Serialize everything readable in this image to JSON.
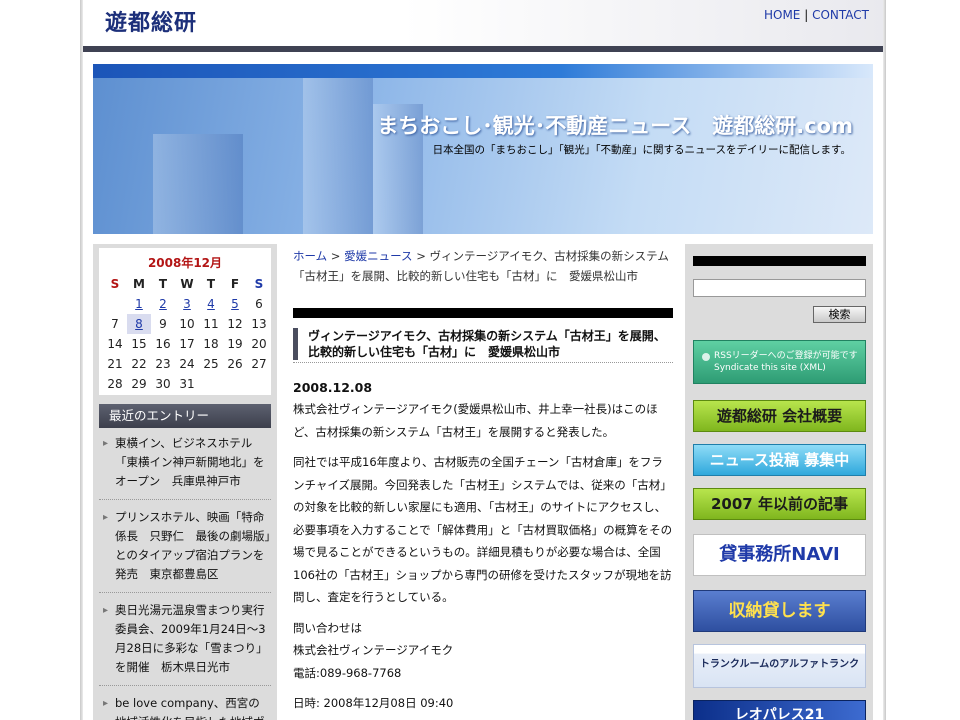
{
  "header": {
    "logo": "遊都総研",
    "nav_home": "HOME",
    "nav_sep": "|",
    "nav_contact": "CONTACT"
  },
  "banner": {
    "title": "まちおこし･観光･不動産ニュース　遊都総研.com",
    "subtitle": "日本全国の「まちおこし」「観光」「不動産」に関するニュースをデイリーに配信します。"
  },
  "calendar": {
    "title": "2008年12月",
    "weekdays": [
      "S",
      "M",
      "T",
      "W",
      "T",
      "F",
      "S"
    ],
    "weeks": [
      [
        "",
        "1",
        "2",
        "3",
        "4",
        "5",
        "6"
      ],
      [
        "7",
        "8",
        "9",
        "10",
        "11",
        "12",
        "13"
      ],
      [
        "14",
        "15",
        "16",
        "17",
        "18",
        "19",
        "20"
      ],
      [
        "21",
        "22",
        "23",
        "24",
        "25",
        "26",
        "27"
      ],
      [
        "28",
        "29",
        "30",
        "31",
        "",
        "",
        ""
      ]
    ]
  },
  "recent": {
    "heading": "最近のエントリー",
    "items": [
      "東横イン、ビジネスホテル「東横イン神戸新開地北」をオープン　兵庫県神戸市",
      "プリンスホテル、映画「特命係長　只野仁　最後の劇場版」とのタイアップ宿泊プランを発売　東京都豊島区",
      "奥日光湯元温泉雪まつり実行委員会、2009年1月24日～3月28日に多彩な「雪まつり」を開催　栃木県日光市",
      "be love company、西宮の地域活性化を目指した地域ポ"
    ]
  },
  "breadcrumb": {
    "home": "ホーム",
    "sep1": " > ",
    "category": "愛媛ニュース",
    "sep2": " > ",
    "current": "ヴィンテージアイモク、古材採集の新システム「古材王」を展開、比較的新しい住宅も「古材」に　愛媛県松山市"
  },
  "article": {
    "title": "ヴィンテージアイモク、古材採集の新システム「古材王」を展開、比較的新しい住宅も「古材」に　愛媛県松山市",
    "date": "2008.12.08",
    "paragraphs": [
      "株式会社ヴィンテージアイモク(愛媛県松山市、井上幸一社長)はこのほど、古材採集の新システム「古材王」を展開すると発表した。",
      "同社では平成16年度より、古材販売の全国チェーン「古材倉庫」をフランチャイズ展開。今回発表した「古材王」システムでは、従来の「古材」の対象を比較的新しい家屋にも適用、「古材王」のサイトにアクセスし、必要事項を入力することで「解体費用」と「古材買取価格」の概算をその場で見ることができるというもの。詳細見積もりが必要な場合は、全国106社の「古材王」ショップから専門の研修を受けたスタッフが現地を訪問し、査定を行うとしている。",
      "問い合わせは"
    ],
    "contact_company": "株式会社ヴィンテージアイモク",
    "contact_phone": "電話:089-968-7768",
    "datetime": "日時: 2008年12月08日 09:40"
  },
  "sidebar_right": {
    "search_button": "検索",
    "rss_line1": "RSSリーダーへのご登録が可能です",
    "rss_line2": "Syndicate this site (XML)",
    "btn_company": "遊都総研 会社概要",
    "btn_news": "ニュース投稿 募集中",
    "btn_archive": "2007 年以前の記事",
    "btn_kashi": "貸事務所NAVI",
    "btn_storage": "収納貸します",
    "btn_trunk": "トランクルームのアルファトランク",
    "btn_reo": "レオパレス21"
  },
  "colors": {
    "brand_navy": "#1c2f7a",
    "link_blue": "#1f3aa8",
    "calendar_red": "#b31515",
    "nav_bar": "#3f4253"
  }
}
